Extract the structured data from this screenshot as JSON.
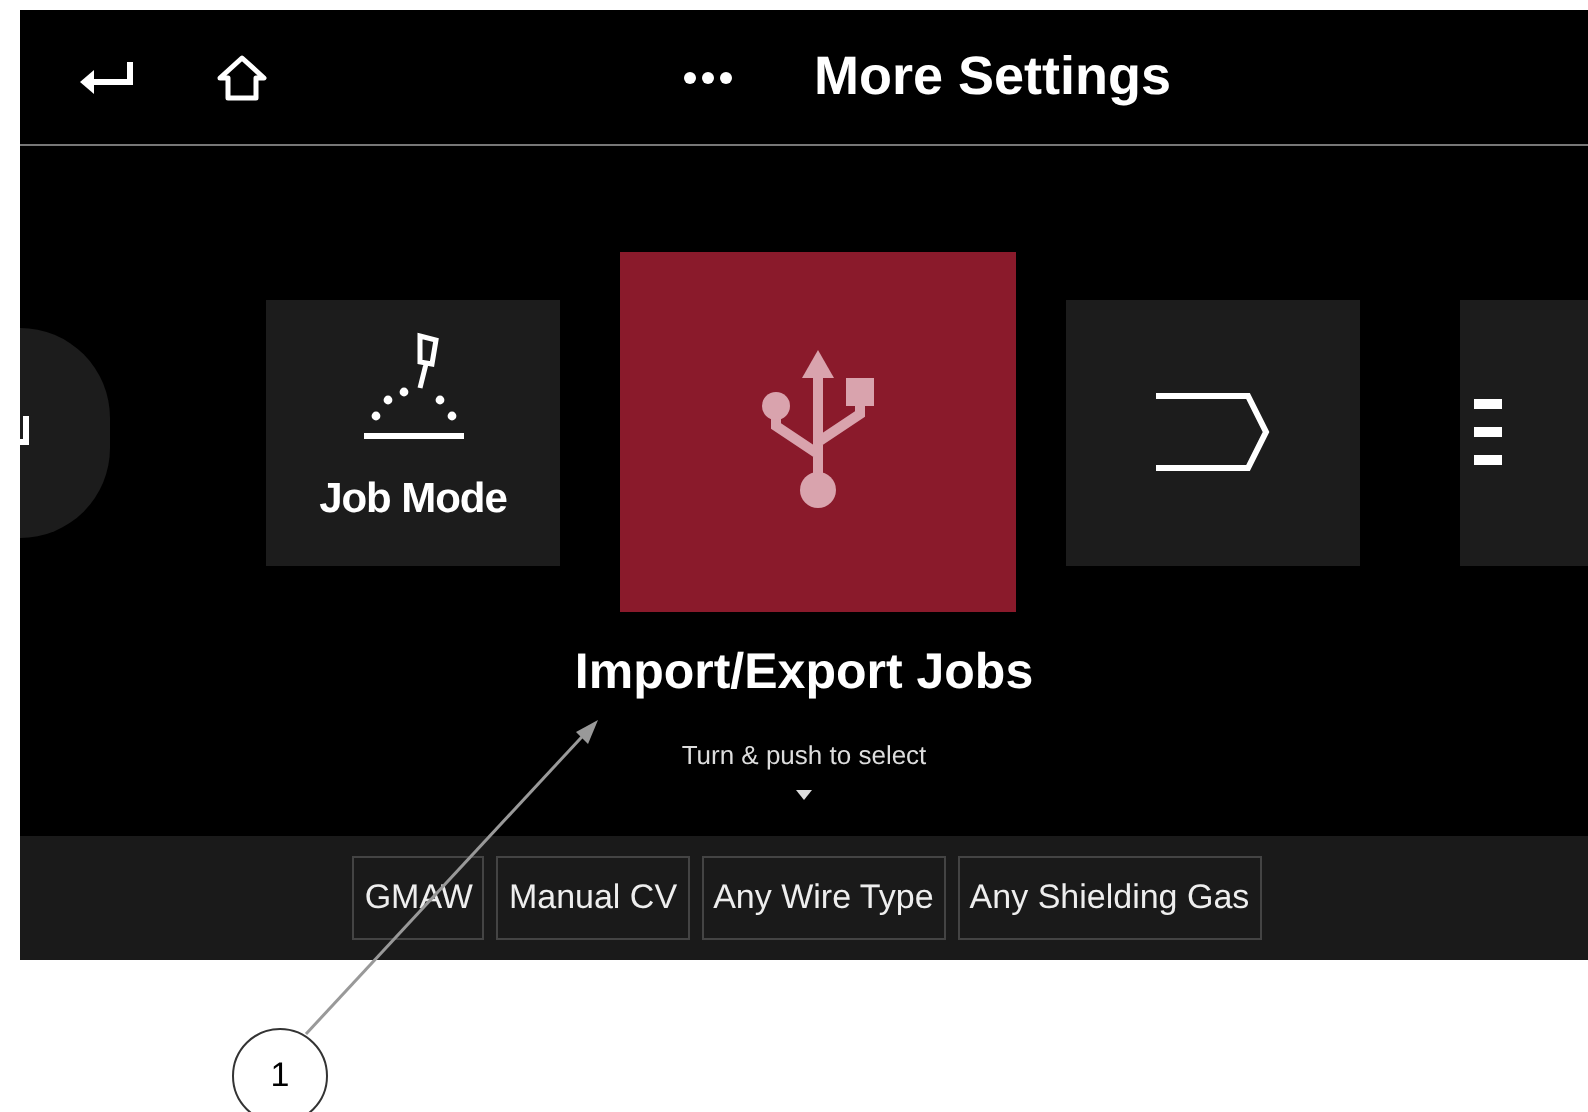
{
  "header": {
    "title": "More Settings"
  },
  "tiles": [
    {
      "kind": "round",
      "selected": false
    },
    {
      "kind": "job",
      "label": "Job Mode",
      "selected": false
    },
    {
      "kind": "usb",
      "selected": true
    },
    {
      "kind": "bracket",
      "selected": false
    },
    {
      "kind": "list",
      "selected": false
    }
  ],
  "selected_label": "Import/Export Jobs",
  "hint": "Turn & push to select",
  "chips": [
    "GMAW",
    "Manual CV",
    "Any Wire Type",
    "Any Shielding Gas"
  ],
  "callout": {
    "number": "1"
  }
}
